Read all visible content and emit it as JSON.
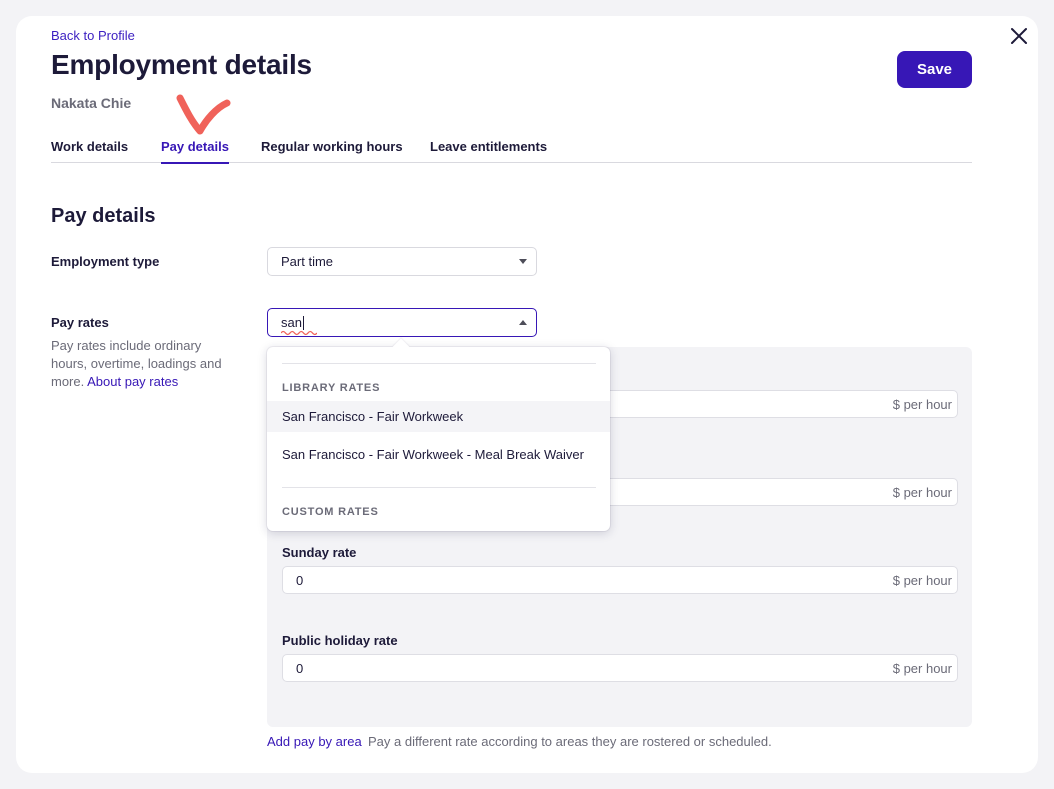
{
  "header": {
    "back_link": "Back to Profile",
    "title": "Employment details",
    "subtitle": "Nakata Chie",
    "save_label": "Save"
  },
  "tabs": [
    {
      "label": "Work details",
      "active": false
    },
    {
      "label": "Pay details",
      "active": true
    },
    {
      "label": "Regular working hours",
      "active": false
    },
    {
      "label": "Leave entitlements",
      "active": false
    }
  ],
  "pay_details": {
    "section_title": "Pay details",
    "employment_type": {
      "label": "Employment type",
      "value": "Part time"
    },
    "pay_rates": {
      "label": "Pay rates",
      "help": "Pay rates include ordinary hours, overtime, loadings and more.",
      "help_link": "About pay rates",
      "search_value": "san"
    },
    "rates": [
      {
        "label": "",
        "value": "",
        "suffix": "$ per hour"
      },
      {
        "label": "",
        "value": "",
        "suffix": "$ per hour"
      },
      {
        "label": "Sunday rate",
        "value": "0",
        "suffix": "$ per hour"
      },
      {
        "label": "Public holiday rate",
        "value": "0",
        "suffix": "$ per hour"
      }
    ],
    "footer": {
      "link": "Add pay by area",
      "text": "Pay a different rate according to areas they are rostered or scheduled."
    }
  },
  "dropdown": {
    "library_heading": "LIBRARY RATES",
    "library_items": [
      "San Francisco - Fair Workweek",
      "San Francisco - Fair Workweek - Meal Break Waiver"
    ],
    "custom_heading": "CUSTOM RATES"
  },
  "colors": {
    "accent": "#3717b6",
    "annotation": "#f0625a"
  }
}
